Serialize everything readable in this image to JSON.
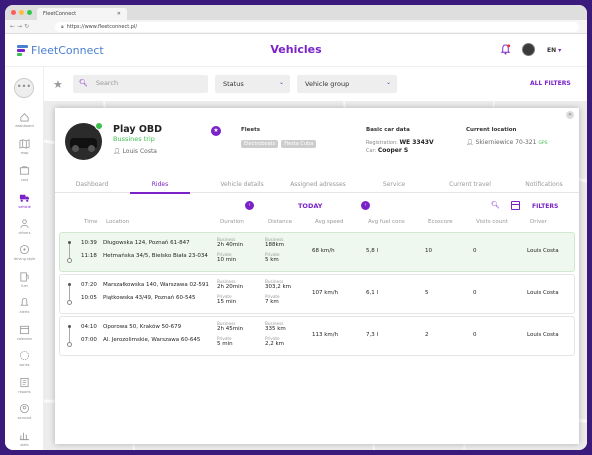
{
  "browser": {
    "tab_title": "FleetConnect",
    "url": "https://www.fleetconnect.pl/"
  },
  "header": {
    "logo_text": "FleetConnect",
    "page_title": "Vehicles",
    "language": "EN"
  },
  "sidebar": {
    "items": [
      {
        "label": "dashboard",
        "icon": "home-icon"
      },
      {
        "label": "map",
        "icon": "map-icon"
      },
      {
        "label": "cost",
        "icon": "wallet-icon"
      },
      {
        "label": "vehicle",
        "icon": "truck-icon",
        "active": true
      },
      {
        "label": "drivers",
        "icon": "driver-icon"
      },
      {
        "label": "driving style",
        "icon": "steering-icon"
      },
      {
        "label": "fuel",
        "icon": "fuel-icon"
      },
      {
        "label": "alerts",
        "icon": "bell-icon"
      },
      {
        "label": "calendar",
        "icon": "calendar-icon"
      },
      {
        "label": "zones",
        "icon": "zone-icon"
      },
      {
        "label": "reports",
        "icon": "report-icon"
      },
      {
        "label": "account",
        "icon": "account-icon"
      },
      {
        "label": "stats",
        "icon": "stats-icon"
      }
    ]
  },
  "filters": {
    "search_placeholder": "Search",
    "status_label": "Status",
    "vehicle_group_label": "Vehicle group",
    "all_filters_label": "ALL FILTERS"
  },
  "vehicle": {
    "name": "Play OBD",
    "trip_type": "Bussines trip",
    "driver": "Louis Costa",
    "fleets_label": "Fleets",
    "fleets": [
      "Electroboats",
      "Fiesta Cuba"
    ],
    "basic_car_data_label": "Basic car data",
    "registration_label": "Registration:",
    "registration": "WE  3343V",
    "car_label": "Car:",
    "car": "Cooper S",
    "location_label": "Current location",
    "location": "Skierniewice 70-321",
    "gps": "GPS"
  },
  "tabs": [
    "Dashboard",
    "Rides",
    "Vehicle details",
    "Assigned adresses",
    "Service",
    "Current travel",
    "Notifications"
  ],
  "date_nav": {
    "label": "TODAY",
    "filters_label": "FILTERS"
  },
  "table": {
    "columns": [
      "Time",
      "Location",
      "Duration",
      "Distance",
      "Avg speed",
      "Avg fuel cons",
      "Ecoscore",
      "Visits count",
      "Driver"
    ],
    "business_label": "Business",
    "private_label": "Private",
    "rows": [
      {
        "start_time": "10:39",
        "end_time": "11:18",
        "start_location": "Długowska 124, Poznań 61-847",
        "end_location": "Hetmańska 34/5, Bielsko Biała 23-034",
        "duration_business": "2h 40min",
        "duration_private": "10 min",
        "distance_business": "188km",
        "distance_private": "5 km",
        "avg_speed": "68 km/h",
        "avg_fuel": "5,8 l",
        "ecoscore": "10",
        "visits": "0",
        "driver": "Louis Costa"
      },
      {
        "start_time": "07:20",
        "end_time": "10:05",
        "start_location": "Marszałkowska 140, Warszawa 02-591",
        "end_location": "Piątkowska 43/49, Poznań 60-545",
        "duration_business": "2h 20min",
        "duration_private": "15 min",
        "distance_business": "303,2 km",
        "distance_private": "7 km",
        "avg_speed": "107 km/h",
        "avg_fuel": "6,1 l",
        "ecoscore": "5",
        "visits": "0",
        "driver": "Louis Costa"
      },
      {
        "start_time": "04:10",
        "end_time": "07:00",
        "start_location": "Oporowa 50, Kraków 50-679",
        "end_location": "Al. Jerozolimskie, Warszawa 60-645",
        "duration_business": "2h 45min",
        "duration_private": "5 min",
        "distance_business": "335 km",
        "distance_private": "2,2 km",
        "avg_speed": "113 km/h",
        "avg_fuel": "7,3 l",
        "ecoscore": "2",
        "visits": "0",
        "driver": "Louis Costa"
      }
    ]
  },
  "colors": {
    "accent": "#7a22c8",
    "green": "#3dbf4e",
    "frame": "#3a1a7a"
  }
}
